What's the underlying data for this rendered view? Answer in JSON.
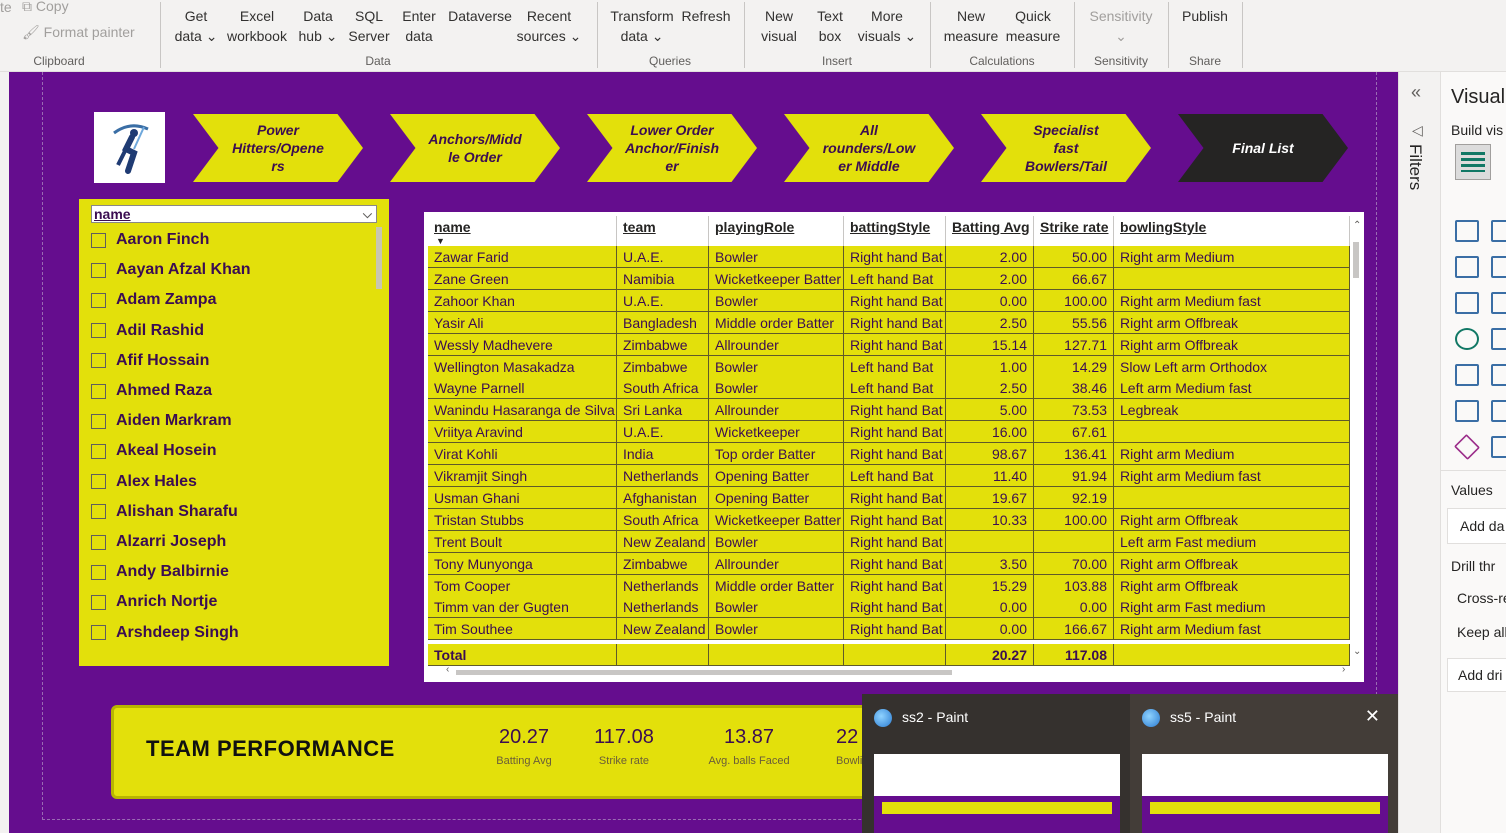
{
  "ribbon": {
    "clipboard": {
      "copy": "Copy",
      "format_painter": "Format painter",
      "group": "Clipboard",
      "cut_edge": "te"
    },
    "data": {
      "get_data_1": "Get",
      "get_data_2": "data ⌄",
      "excel_1": "Excel",
      "excel_2": "workbook",
      "hub_1": "Data",
      "hub_2": "hub ⌄",
      "sql_1": "SQL",
      "sql_2": "Server",
      "enter_1": "Enter",
      "enter_2": "data",
      "dataverse": "Dataverse",
      "recent_1": "Recent",
      "recent_2": "sources ⌄",
      "group": "Data"
    },
    "queries": {
      "transform_1": "Transform",
      "transform_2": "data ⌄",
      "refresh": "Refresh",
      "group": "Queries"
    },
    "insert": {
      "new_visual_1": "New",
      "new_visual_2": "visual",
      "text_box_1": "Text",
      "text_box_2": "box",
      "more_1": "More",
      "more_2": "visuals ⌄",
      "group": "Insert"
    },
    "calculations": {
      "new_measure_1": "New",
      "new_measure_2": "measure",
      "quick_1": "Quick",
      "quick_2": "measure",
      "group": "Calculations"
    },
    "sensitivity": {
      "label": "Sensitivity",
      "chev": "⌄",
      "group": "Sensitivity"
    },
    "share": {
      "publish": "Publish",
      "group": "Share"
    }
  },
  "nav": [
    "Power Hitters/Openers",
    "Anchors/Middle Order",
    "Lower Order Anchor/Finisher",
    "All rounders/Lower Middle",
    "Specialist fast Bowlers/Tail",
    "Final List"
  ],
  "nav_display": [
    "Power\nHitters/Opene\nrs",
    "Anchors/Midd\nle Order",
    "Lower Order\nAnchor/Finish\ner",
    "All\nrounders/Low\ner Middle",
    "Specialist\nfast\nBowlers/Tail",
    "Final List"
  ],
  "slicer": {
    "header": "name",
    "items": [
      "Aaron Finch",
      "Aayan Afzal Khan",
      "Adam Zampa",
      "Adil Rashid",
      "Afif Hossain",
      "Ahmed Raza",
      "Aiden Markram",
      "Akeal Hosein",
      "Alex Hales",
      "Alishan Sharafu",
      "Alzarri Joseph",
      "Andy Balbirnie",
      "Anrich Nortje",
      "Arshdeep Singh"
    ]
  },
  "table": {
    "columns": [
      "name",
      "team",
      "playingRole",
      "battingStyle",
      "Batting Avg",
      "Strike rate",
      "bowlingStyle"
    ],
    "rows": [
      [
        "Zawar Farid",
        "U.A.E.",
        "Bowler",
        "Right hand Bat",
        "2.00",
        "50.00",
        "Right arm Medium"
      ],
      [
        "Zane Green",
        "Namibia",
        "Wicketkeeper Batter",
        "Left hand Bat",
        "2.00",
        "66.67",
        ""
      ],
      [
        "Zahoor Khan",
        "U.A.E.",
        "Bowler",
        "Right hand Bat",
        "0.00",
        "100.00",
        "Right arm Medium fast"
      ],
      [
        "Yasir Ali",
        "Bangladesh",
        "Middle order Batter",
        "Right hand Bat",
        "2.50",
        "55.56",
        "Right arm Offbreak"
      ],
      [
        "Wessly Madhevere",
        "Zimbabwe",
        "Allrounder",
        "Right hand Bat",
        "15.14",
        "127.71",
        "Right arm Offbreak"
      ],
      [
        "Wellington Masakadza",
        "Zimbabwe",
        "Bowler",
        "Left hand Bat",
        "1.00",
        "14.29",
        "Slow Left arm Orthodox"
      ],
      [
        "Wayne Parnell",
        "South Africa",
        "Bowler",
        "Left hand Bat",
        "2.50",
        "38.46",
        "Left arm Medium fast"
      ],
      [
        "Wanindu Hasaranga de Silva",
        "Sri Lanka",
        "Allrounder",
        "Right hand Bat",
        "5.00",
        "73.53",
        "Legbreak"
      ],
      [
        "Vriitya Aravind",
        "U.A.E.",
        "Wicketkeeper",
        "Right hand Bat",
        "16.00",
        "67.61",
        ""
      ],
      [
        "Virat Kohli",
        "India",
        "Top order Batter",
        "Right hand Bat",
        "98.67",
        "136.41",
        "Right arm Medium"
      ],
      [
        "Vikramjit Singh",
        "Netherlands",
        "Opening Batter",
        "Left hand Bat",
        "11.40",
        "91.94",
        "Right arm Medium fast"
      ],
      [
        "Usman Ghani",
        "Afghanistan",
        "Opening Batter",
        "Right hand Bat",
        "19.67",
        "92.19",
        ""
      ],
      [
        "Tristan Stubbs",
        "South Africa",
        "Wicketkeeper Batter",
        "Right hand Bat",
        "10.33",
        "100.00",
        "Right arm Offbreak"
      ],
      [
        "Trent Boult",
        "New Zealand",
        "Bowler",
        "Right hand Bat",
        "",
        "",
        "Left arm Fast medium"
      ],
      [
        "Tony Munyonga",
        "Zimbabwe",
        "Allrounder",
        "Right hand Bat",
        "3.50",
        "70.00",
        "Right arm Offbreak"
      ],
      [
        "Tom Cooper",
        "Netherlands",
        "Middle order Batter",
        "Right hand Bat",
        "15.29",
        "103.88",
        "Right arm Offbreak"
      ],
      [
        "Timm van der Gugten",
        "Netherlands",
        "Bowler",
        "Right hand Bat",
        "0.00",
        "0.00",
        "Right arm Fast medium"
      ],
      [
        "Tim Southee",
        "New Zealand",
        "Bowler",
        "Right hand Bat",
        "0.00",
        "166.67",
        "Right arm Medium fast"
      ]
    ],
    "total": [
      "Total",
      "",
      "",
      "",
      "20.27",
      "117.08",
      ""
    ]
  },
  "kpi": {
    "title": "TEAM PERFORMANCE",
    "cards": [
      {
        "value": "20.27",
        "label": "Batting Avg"
      },
      {
        "value": "117.08",
        "label": "Strike rate"
      },
      {
        "value": "13.87",
        "label": "Avg. balls Faced"
      },
      {
        "value": "22",
        "label": "Bowlin"
      }
    ]
  },
  "filters_label": "Filters",
  "viz_pane": {
    "title": "Visual",
    "build": "Build vis",
    "values": "Values",
    "add_data": "Add da",
    "drill": "Drill thr",
    "cross": "Cross-re",
    "keep": "Keep all",
    "add_drill": "Add dri"
  },
  "taskbar": [
    {
      "title": "ss2 - Paint"
    },
    {
      "title": "ss5 - Paint"
    }
  ],
  "colors": {
    "canvas": "#650d8e",
    "accent": "#e3e00b",
    "dark_chevron": "#252423"
  }
}
